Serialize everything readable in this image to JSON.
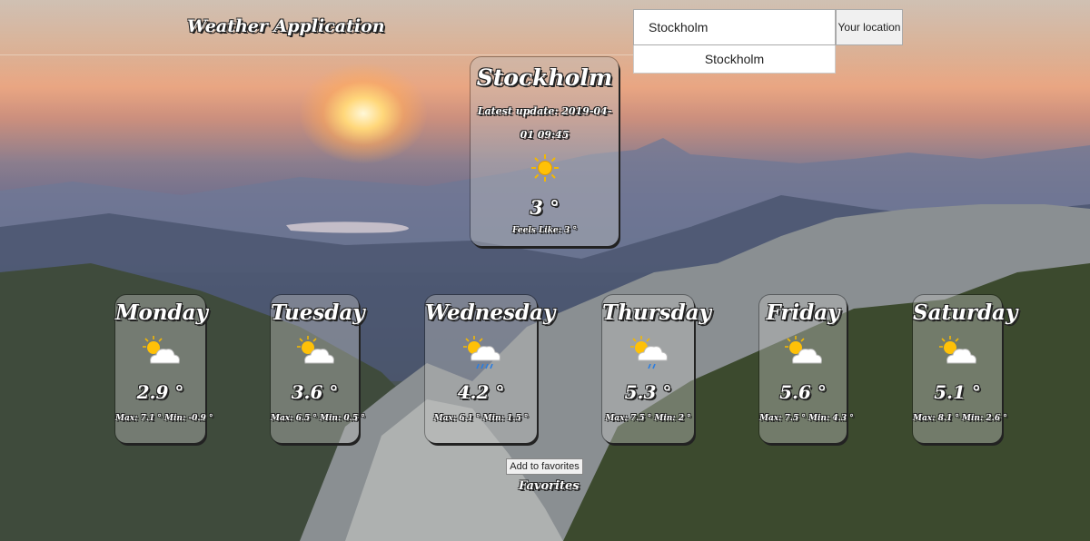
{
  "header": {
    "title": "Weather Application"
  },
  "search": {
    "value": "Stockholm",
    "location_button": "Your location",
    "suggestion": "Stockholm"
  },
  "current": {
    "city": "Stockholm",
    "update_label": "Latest update: 2019-04-01 09:45",
    "icon": "sun-icon",
    "temperature": "3 °",
    "feels_like": "Feels Like: 3 °"
  },
  "forecast": [
    {
      "day": "Monday",
      "icon": "partly-cloudy-icon",
      "temp": "2.9 °",
      "minmax": "Max: 7.1 ° Min: -0.9 °"
    },
    {
      "day": "Tuesday",
      "icon": "partly-cloudy-icon",
      "temp": "3.6 °",
      "minmax": "Max: 6.5 ° Min: 0.5 °"
    },
    {
      "day": "Wednesday",
      "icon": "partly-cloudy-rain-icon",
      "temp": "4.2 °",
      "minmax": "Max: 6.1 °   Min: 1.5 °"
    },
    {
      "day": "Thursday",
      "icon": "partly-cloudy-rain-icon",
      "temp": "5.3 °",
      "minmax": "Max: 7.5 ° Min: 2 °"
    },
    {
      "day": "Friday",
      "icon": "partly-cloudy-icon",
      "temp": "5.6 °",
      "minmax": "Max: 7.5 ° Min: 4.3 °"
    },
    {
      "day": "Saturday",
      "icon": "partly-cloudy-icon",
      "temp": "5.1 °",
      "minmax": "Max: 8.1 ° Min: 2.6 °"
    }
  ],
  "favorites": {
    "add_button": "Add to favorites",
    "label": "Favorites"
  }
}
